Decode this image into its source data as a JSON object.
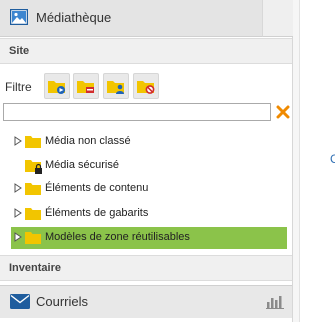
{
  "header": {
    "title": "Médiathèque",
    "icon": "image-icon"
  },
  "site_section": {
    "title": "Site"
  },
  "filter": {
    "label": "Filtre",
    "buttons": [
      {
        "icon": "folder-blue-badge-icon"
      },
      {
        "icon": "folder-red-badge-icon"
      },
      {
        "icon": "folder-user-icon"
      },
      {
        "icon": "folder-forbidden-icon"
      }
    ],
    "search": {
      "value": "",
      "placeholder": ""
    },
    "clear_icon": "clear-x-icon"
  },
  "tree": {
    "items": [
      {
        "label": "Média non classé",
        "expandable": true,
        "locked": false,
        "selected": false
      },
      {
        "label": "Média sécurisé",
        "expandable": false,
        "locked": true,
        "selected": false
      },
      {
        "label": "Éléments de contenu",
        "expandable": true,
        "locked": false,
        "selected": false
      },
      {
        "label": "Éléments de gabarits",
        "expandable": true,
        "locked": false,
        "selected": false
      },
      {
        "label": "Modèles de zone réutilisables",
        "expandable": true,
        "locked": false,
        "selected": true
      }
    ]
  },
  "inventaire_section": {
    "title": "Inventaire"
  },
  "footer": {
    "label": "Courriels",
    "icon": "mail-icon",
    "stats_icon": "bar-chart-icon"
  },
  "right_fragment": {
    "text": "C"
  },
  "colors": {
    "selected_row": "#8bc34a",
    "folder": "#f2c500",
    "accent_blue": "#1f5d9e",
    "clear_orange": "#f08a00"
  }
}
